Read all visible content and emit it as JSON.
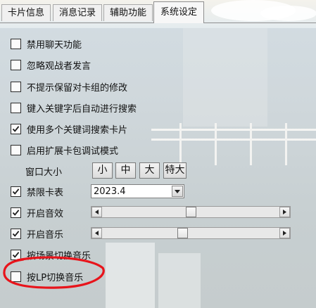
{
  "tabs": [
    {
      "label": "卡片信息"
    },
    {
      "label": "消息记录"
    },
    {
      "label": "辅助功能"
    },
    {
      "label": "系统设定"
    }
  ],
  "options": [
    {
      "label": "禁用聊天功能",
      "checked": false
    },
    {
      "label": "忽略观战者发言",
      "checked": false
    },
    {
      "label": "不提示保留对卡组的修改",
      "checked": false
    },
    {
      "label": "键入关键字后自动进行搜索",
      "checked": false
    },
    {
      "label": "使用多个关键词搜索卡片",
      "checked": true
    },
    {
      "label": "启用扩展卡包调试模式",
      "checked": false
    }
  ],
  "window_size": {
    "label": "窗口大小",
    "buttons": [
      "小",
      "中",
      "大",
      "特大"
    ]
  },
  "banlist": {
    "label": "禁限卡表",
    "checked": true,
    "selected": "2023.4"
  },
  "sound": {
    "label": "开启音效",
    "checked": true,
    "level": 0.5
  },
  "music": {
    "label": "开启音乐",
    "checked": true,
    "level": 0.45
  },
  "scene_music": {
    "label": "按场景切换音乐",
    "checked": true
  },
  "lp_music": {
    "label": "按LP切换音乐",
    "checked": false
  },
  "colors": {
    "highlight": "#e8141b",
    "checkmark": "#1a1a1a"
  }
}
